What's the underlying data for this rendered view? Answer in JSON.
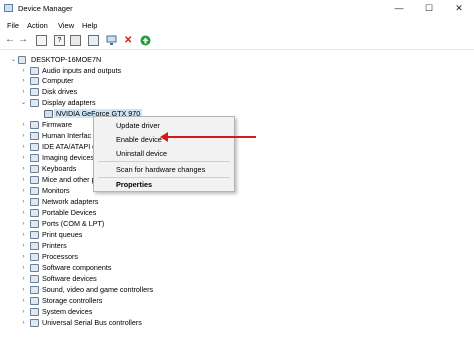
{
  "window": {
    "title": "Device Manager",
    "controls": [
      "—",
      "☐",
      "✕"
    ]
  },
  "menu": [
    "File",
    "Action",
    "View",
    "Help"
  ],
  "toolbar": [
    "back-icon",
    "forward-icon",
    "properties-icon",
    "help-icon",
    "update-icon",
    "scan-icon",
    "enable-icon",
    "uninstall-icon",
    "add-icon"
  ],
  "tree": {
    "root": "DESKTOP-16MOE7N",
    "items": [
      "Audio inputs and outputs",
      "Computer",
      "Disk drives",
      "Display adapters",
      "NVIDIA GeForce GTX 970",
      "Firmware",
      "Human Interface Devices",
      "IDE ATA/ATAPI controllers",
      "Imaging devices",
      "Keyboards",
      "Mice and other pointing devices",
      "Monitors",
      "Network adapters",
      "Portable Devices",
      "Ports (COM & LPT)",
      "Print queues",
      "Printers",
      "Processors",
      "Software components",
      "Software devices",
      "Sound, video and game controllers",
      "Storage controllers",
      "System devices",
      "Universal Serial Bus controllers"
    ],
    "visible_labels": {
      "Human Interface Devices": "Human Interfac",
      "IDE ATA/ATAPI controllers": "IDE ATA/ATAPI c",
      "Mice and other pointing devices": "Mice and other p"
    }
  },
  "context_menu": {
    "items": [
      "Update driver",
      "Enable device",
      "Uninstall device",
      "Scan for hardware changes",
      "Properties"
    ]
  },
  "colors": {
    "arrow": "#d41a1a",
    "selection": "#cce4f7"
  }
}
